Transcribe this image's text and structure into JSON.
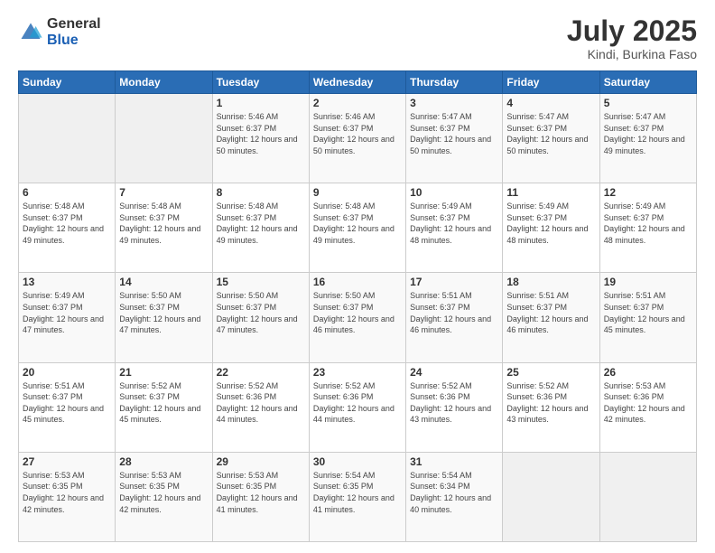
{
  "logo": {
    "general": "General",
    "blue": "Blue"
  },
  "header": {
    "month": "July 2025",
    "location": "Kindi, Burkina Faso"
  },
  "weekdays": [
    "Sunday",
    "Monday",
    "Tuesday",
    "Wednesday",
    "Thursday",
    "Friday",
    "Saturday"
  ],
  "weeks": [
    [
      {
        "day": "",
        "sunrise": "",
        "sunset": "",
        "daylight": ""
      },
      {
        "day": "",
        "sunrise": "",
        "sunset": "",
        "daylight": ""
      },
      {
        "day": "1",
        "sunrise": "Sunrise: 5:46 AM",
        "sunset": "Sunset: 6:37 PM",
        "daylight": "Daylight: 12 hours and 50 minutes."
      },
      {
        "day": "2",
        "sunrise": "Sunrise: 5:46 AM",
        "sunset": "Sunset: 6:37 PM",
        "daylight": "Daylight: 12 hours and 50 minutes."
      },
      {
        "day": "3",
        "sunrise": "Sunrise: 5:47 AM",
        "sunset": "Sunset: 6:37 PM",
        "daylight": "Daylight: 12 hours and 50 minutes."
      },
      {
        "day": "4",
        "sunrise": "Sunrise: 5:47 AM",
        "sunset": "Sunset: 6:37 PM",
        "daylight": "Daylight: 12 hours and 50 minutes."
      },
      {
        "day": "5",
        "sunrise": "Sunrise: 5:47 AM",
        "sunset": "Sunset: 6:37 PM",
        "daylight": "Daylight: 12 hours and 49 minutes."
      }
    ],
    [
      {
        "day": "6",
        "sunrise": "Sunrise: 5:48 AM",
        "sunset": "Sunset: 6:37 PM",
        "daylight": "Daylight: 12 hours and 49 minutes."
      },
      {
        "day": "7",
        "sunrise": "Sunrise: 5:48 AM",
        "sunset": "Sunset: 6:37 PM",
        "daylight": "Daylight: 12 hours and 49 minutes."
      },
      {
        "day": "8",
        "sunrise": "Sunrise: 5:48 AM",
        "sunset": "Sunset: 6:37 PM",
        "daylight": "Daylight: 12 hours and 49 minutes."
      },
      {
        "day": "9",
        "sunrise": "Sunrise: 5:48 AM",
        "sunset": "Sunset: 6:37 PM",
        "daylight": "Daylight: 12 hours and 49 minutes."
      },
      {
        "day": "10",
        "sunrise": "Sunrise: 5:49 AM",
        "sunset": "Sunset: 6:37 PM",
        "daylight": "Daylight: 12 hours and 48 minutes."
      },
      {
        "day": "11",
        "sunrise": "Sunrise: 5:49 AM",
        "sunset": "Sunset: 6:37 PM",
        "daylight": "Daylight: 12 hours and 48 minutes."
      },
      {
        "day": "12",
        "sunrise": "Sunrise: 5:49 AM",
        "sunset": "Sunset: 6:37 PM",
        "daylight": "Daylight: 12 hours and 48 minutes."
      }
    ],
    [
      {
        "day": "13",
        "sunrise": "Sunrise: 5:49 AM",
        "sunset": "Sunset: 6:37 PM",
        "daylight": "Daylight: 12 hours and 47 minutes."
      },
      {
        "day": "14",
        "sunrise": "Sunrise: 5:50 AM",
        "sunset": "Sunset: 6:37 PM",
        "daylight": "Daylight: 12 hours and 47 minutes."
      },
      {
        "day": "15",
        "sunrise": "Sunrise: 5:50 AM",
        "sunset": "Sunset: 6:37 PM",
        "daylight": "Daylight: 12 hours and 47 minutes."
      },
      {
        "day": "16",
        "sunrise": "Sunrise: 5:50 AM",
        "sunset": "Sunset: 6:37 PM",
        "daylight": "Daylight: 12 hours and 46 minutes."
      },
      {
        "day": "17",
        "sunrise": "Sunrise: 5:51 AM",
        "sunset": "Sunset: 6:37 PM",
        "daylight": "Daylight: 12 hours and 46 minutes."
      },
      {
        "day": "18",
        "sunrise": "Sunrise: 5:51 AM",
        "sunset": "Sunset: 6:37 PM",
        "daylight": "Daylight: 12 hours and 46 minutes."
      },
      {
        "day": "19",
        "sunrise": "Sunrise: 5:51 AM",
        "sunset": "Sunset: 6:37 PM",
        "daylight": "Daylight: 12 hours and 45 minutes."
      }
    ],
    [
      {
        "day": "20",
        "sunrise": "Sunrise: 5:51 AM",
        "sunset": "Sunset: 6:37 PM",
        "daylight": "Daylight: 12 hours and 45 minutes."
      },
      {
        "day": "21",
        "sunrise": "Sunrise: 5:52 AM",
        "sunset": "Sunset: 6:37 PM",
        "daylight": "Daylight: 12 hours and 45 minutes."
      },
      {
        "day": "22",
        "sunrise": "Sunrise: 5:52 AM",
        "sunset": "Sunset: 6:36 PM",
        "daylight": "Daylight: 12 hours and 44 minutes."
      },
      {
        "day": "23",
        "sunrise": "Sunrise: 5:52 AM",
        "sunset": "Sunset: 6:36 PM",
        "daylight": "Daylight: 12 hours and 44 minutes."
      },
      {
        "day": "24",
        "sunrise": "Sunrise: 5:52 AM",
        "sunset": "Sunset: 6:36 PM",
        "daylight": "Daylight: 12 hours and 43 minutes."
      },
      {
        "day": "25",
        "sunrise": "Sunrise: 5:52 AM",
        "sunset": "Sunset: 6:36 PM",
        "daylight": "Daylight: 12 hours and 43 minutes."
      },
      {
        "day": "26",
        "sunrise": "Sunrise: 5:53 AM",
        "sunset": "Sunset: 6:36 PM",
        "daylight": "Daylight: 12 hours and 42 minutes."
      }
    ],
    [
      {
        "day": "27",
        "sunrise": "Sunrise: 5:53 AM",
        "sunset": "Sunset: 6:35 PM",
        "daylight": "Daylight: 12 hours and 42 minutes."
      },
      {
        "day": "28",
        "sunrise": "Sunrise: 5:53 AM",
        "sunset": "Sunset: 6:35 PM",
        "daylight": "Daylight: 12 hours and 42 minutes."
      },
      {
        "day": "29",
        "sunrise": "Sunrise: 5:53 AM",
        "sunset": "Sunset: 6:35 PM",
        "daylight": "Daylight: 12 hours and 41 minutes."
      },
      {
        "day": "30",
        "sunrise": "Sunrise: 5:54 AM",
        "sunset": "Sunset: 6:35 PM",
        "daylight": "Daylight: 12 hours and 41 minutes."
      },
      {
        "day": "31",
        "sunrise": "Sunrise: 5:54 AM",
        "sunset": "Sunset: 6:34 PM",
        "daylight": "Daylight: 12 hours and 40 minutes."
      },
      {
        "day": "",
        "sunrise": "",
        "sunset": "",
        "daylight": ""
      },
      {
        "day": "",
        "sunrise": "",
        "sunset": "",
        "daylight": ""
      }
    ]
  ]
}
